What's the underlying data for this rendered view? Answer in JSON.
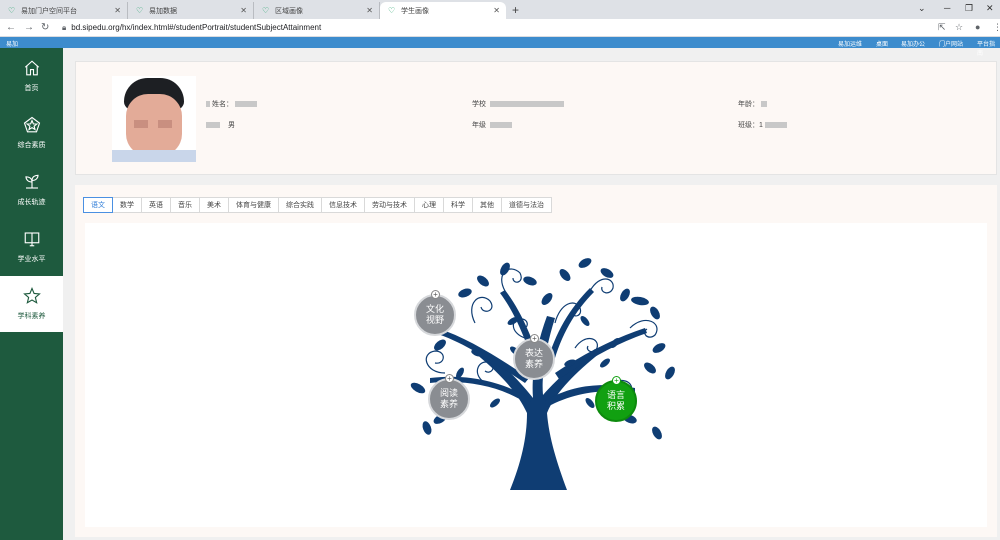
{
  "browser": {
    "tabs": [
      {
        "title": "易加门户空间平台"
      },
      {
        "title": "易加数据"
      },
      {
        "title": "区域画像"
      },
      {
        "title": "学生画像"
      }
    ],
    "url": "bd.sipedu.org/hx/index.html#/studentPortrait/studentSubjectAttainment"
  },
  "topbar": {
    "brand": "易加",
    "menu": [
      "易加运维",
      "桌面",
      "易加办公",
      "门户网站",
      "平台指南"
    ]
  },
  "sidebar": {
    "items": [
      {
        "label": "首页",
        "icon": "home-icon"
      },
      {
        "label": "综合素质",
        "icon": "pentagon-star-icon"
      },
      {
        "label": "成长轨迹",
        "icon": "sprout-icon"
      },
      {
        "label": "学业水平",
        "icon": "book-icon"
      },
      {
        "label": "学科素养",
        "icon": "star-icon"
      }
    ]
  },
  "profile": {
    "name_label": "姓名：",
    "gender_value": "男",
    "school_label": "学校",
    "grade_label": "年级",
    "age_label": "年龄：",
    "class_label": "班级：1"
  },
  "subjects": {
    "tabs": [
      "语文",
      "数学",
      "英语",
      "音乐",
      "美术",
      "体育与健康",
      "综合实践",
      "信息技术",
      "劳动与技术",
      "心理",
      "科学",
      "其他",
      "道德与法治"
    ],
    "active": "语文"
  },
  "tree": {
    "trunk_color": "#0f3d73",
    "nodes": [
      {
        "line1": "文化",
        "line2": "视野",
        "active": false
      },
      {
        "line1": "表达",
        "line2": "素养",
        "active": false
      },
      {
        "line1": "阅读",
        "line2": "素养",
        "active": false
      },
      {
        "line1": "语言",
        "line2": "积累",
        "active": true
      }
    ],
    "active_color": "#11a011"
  }
}
